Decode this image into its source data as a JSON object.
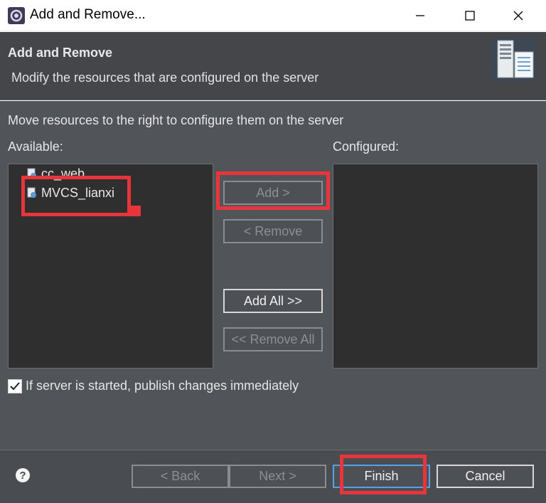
{
  "window": {
    "title": "Add and Remove...",
    "minimize_glyph": "—",
    "maximize_glyph": "☐",
    "close_glyph": "✕"
  },
  "header": {
    "title": "Add and Remove",
    "description": "Modify the resources that are configured on the server"
  },
  "body": {
    "instruction": "Move resources to the right to configure them on the server",
    "available_label": "Available:",
    "configured_label": "Configured:",
    "available_items": [
      {
        "label": "cc_web",
        "icon": "web-project-icon"
      },
      {
        "label": "MVCS_lianxi",
        "icon": "web-project-icon"
      }
    ],
    "configured_items": [],
    "buttons": {
      "add": "Add >",
      "remove": "< Remove",
      "add_all": "Add All >>",
      "remove_all": "<< Remove All"
    },
    "publish_checkbox": {
      "label": "If server is started, publish changes immediately",
      "checked": true
    }
  },
  "footer": {
    "help_glyph": "?",
    "back": "< Back",
    "next": "Next >",
    "finish": "Finish",
    "cancel": "Cancel"
  },
  "colors": {
    "highlight": "#e8353b",
    "header_bg": "#444649",
    "body_bg": "#515459",
    "list_bg": "#2f2f2f"
  }
}
